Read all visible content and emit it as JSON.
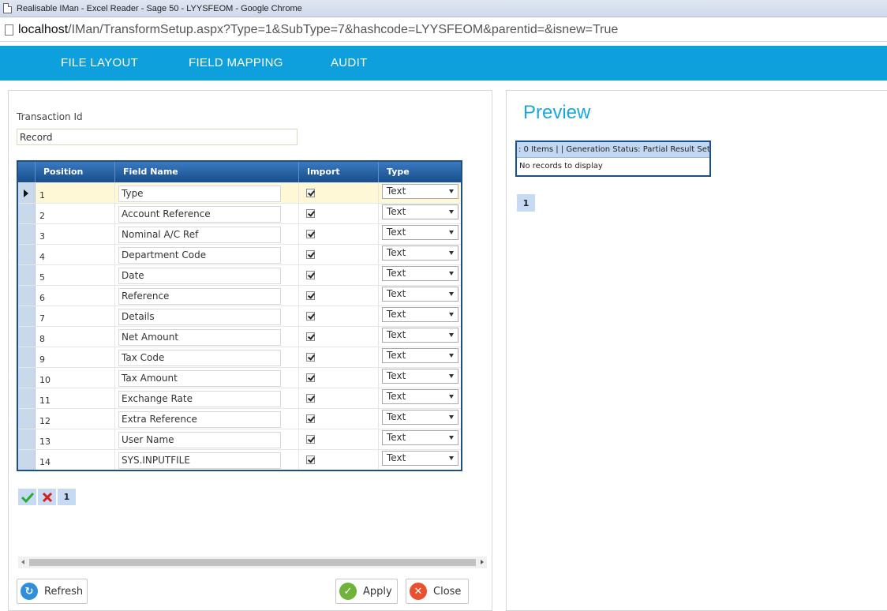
{
  "browser": {
    "window_title": "Realisable IMan - Excel Reader - Sage 50 - LYYSFEOM - Google Chrome",
    "url_host": "localhost",
    "url_path": "/IMan/TransformSetup.aspx?Type=1&SubType=7&hashcode=LYYSFEOM&parentid=&isnew=True"
  },
  "nav": {
    "tabs": [
      {
        "label": "FILE LAYOUT"
      },
      {
        "label": "FIELD MAPPING"
      },
      {
        "label": "AUDIT"
      }
    ]
  },
  "form": {
    "transaction_label": "Transaction Id",
    "transaction_value": "Record"
  },
  "grid": {
    "headers": {
      "position": "Position",
      "field_name": "Field Name",
      "import": "Import",
      "type": "Type"
    },
    "rows": [
      {
        "position": "1",
        "field_name": "Type",
        "type": "Text"
      },
      {
        "position": "2",
        "field_name": "Account Reference",
        "type": "Text"
      },
      {
        "position": "3",
        "field_name": "Nominal A/C Ref",
        "type": "Text"
      },
      {
        "position": "4",
        "field_name": "Department Code",
        "type": "Text"
      },
      {
        "position": "5",
        "field_name": "Date",
        "type": "Text"
      },
      {
        "position": "6",
        "field_name": "Reference",
        "type": "Text"
      },
      {
        "position": "7",
        "field_name": "Details",
        "type": "Text"
      },
      {
        "position": "8",
        "field_name": "Net Amount",
        "type": "Text"
      },
      {
        "position": "9",
        "field_name": "Tax Code",
        "type": "Text"
      },
      {
        "position": "10",
        "field_name": "Tax Amount",
        "type": "Text"
      },
      {
        "position": "11",
        "field_name": "Exchange Rate",
        "type": "Text"
      },
      {
        "position": "12",
        "field_name": "Extra Reference",
        "type": "Text"
      },
      {
        "position": "13",
        "field_name": "User Name",
        "type": "Text"
      },
      {
        "position": "14",
        "field_name": "SYS.INPUTFILE",
        "type": "Text"
      }
    ],
    "pager_page": "1"
  },
  "buttons": {
    "refresh": "Refresh",
    "apply": "Apply",
    "close": "Close"
  },
  "preview": {
    "title": "Preview",
    "status": ": 0 Items | | Generation Status: Partial Result Set",
    "empty_text": "No records to display",
    "pager_page": "1"
  },
  "colors": {
    "nav_bg": "#0da0dc",
    "grid_header": "#1c4f8a",
    "accent": "#1aa7e0"
  }
}
